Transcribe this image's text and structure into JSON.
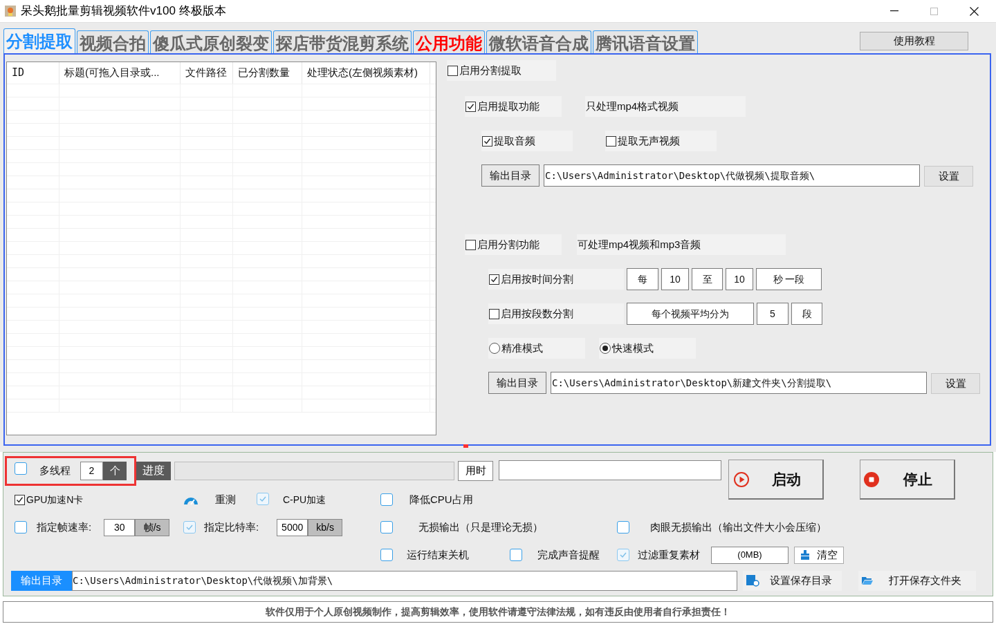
{
  "window": {
    "title": "呆头鹅批量剪辑视频软件v100 终极版本"
  },
  "tabs": [
    {
      "label": "分割提取",
      "selected": true,
      "color": "#1e8fff"
    },
    {
      "label": "视频合拍",
      "selected": false,
      "color": "#666666"
    },
    {
      "label": "傻瓜式原创裂变",
      "selected": false,
      "color": "#666666"
    },
    {
      "label": "探店带货混剪系统",
      "selected": false,
      "color": "#666666"
    },
    {
      "label": "公用功能",
      "selected": false,
      "color": "#ff0000"
    },
    {
      "label": "微软语音合成",
      "selected": false,
      "color": "#666666"
    },
    {
      "label": "腾讯语音设置",
      "selected": false,
      "color": "#666666"
    }
  ],
  "help_button": "使用教程",
  "table": {
    "columns": [
      "ID",
      "标题(可拖入目录或...",
      "文件路径",
      "已分割数量",
      "处理状态(左侧视频素材)"
    ]
  },
  "split_panel": {
    "enable": {
      "label": "启用分割提取",
      "checked": false
    },
    "extract": {
      "label": "启用提取功能",
      "checked": true,
      "note": "只处理mp4格式视频"
    },
    "extract_audio": {
      "label": "提取音频",
      "checked": true
    },
    "extract_silent": {
      "label": "提取无声视频",
      "checked": false
    },
    "extract_output": {
      "button": "输出目录",
      "value": "C:\\Users\\Administrator\\Desktop\\代做视频\\提取音频\\",
      "set": "设置"
    },
    "split": {
      "label": "启用分割功能",
      "checked": false,
      "note": "可处理mp4视频和mp3音频"
    },
    "time_split": {
      "label": "启用按时间分割",
      "checked": true,
      "every": "每",
      "from": "10",
      "to_label": "至",
      "to": "10",
      "unit": "秒 一段"
    },
    "segment_split": {
      "label": "启用按段数分割",
      "checked": false,
      "prefix": "每个视频平均分为",
      "count": "5",
      "unit": "段"
    },
    "modes": [
      {
        "label": "精准模式",
        "selected": false
      },
      {
        "label": "快速模式",
        "selected": true
      }
    ],
    "split_output": {
      "button": "输出目录",
      "value": "C:\\Users\\Administrator\\Desktop\\新建文件夹\\分割提取\\",
      "set": "设置"
    }
  },
  "bottom": {
    "multithread": {
      "label": "多线程",
      "checked": false,
      "count": "2",
      "unit": "个"
    },
    "progress": {
      "label": "进度",
      "level": 0
    },
    "elapsed": {
      "label": "用时"
    },
    "start": "启动",
    "stop": "停止",
    "gpu": {
      "label": "GPU加速N卡",
      "checked": true
    },
    "retest": "重测",
    "cpu_accel": {
      "label": "C-PU加速",
      "checked": true
    },
    "lower_cpu": {
      "label": "降低CPU占用",
      "checked": false
    },
    "frame_rate": {
      "label": "指定帧速率:",
      "checked": false,
      "value": "30",
      "unit": "帧/s"
    },
    "bitrate": {
      "label": "指定比特率:",
      "checked": true,
      "value": "5000",
      "unit": "kb/s"
    },
    "lossless": {
      "label": "无损输出（只是理论无损）",
      "checked": false
    },
    "visual_lossless": {
      "label": "肉眼无损输出（输出文件大小会压缩）",
      "checked": false
    },
    "shutdown": {
      "label": "运行结束关机",
      "checked": false
    },
    "sound": {
      "label": "完成声音提醒",
      "checked": false
    },
    "dedupe": {
      "label": "过滤重复素材",
      "checked": true,
      "size": "(0MB)",
      "clear": "清空"
    },
    "output": {
      "button": "输出目录",
      "value": "C:\\Users\\Administrator\\Desktop\\代做视频\\加背景\\"
    },
    "set_dir": "设置保存目录",
    "open_dir": "打开保存文件夹"
  },
  "footer": "软件仅用于个人原创视频制作，提高剪辑效率，使用软件请遵守法律法规，如有违反由使用者自行承担责任！"
}
